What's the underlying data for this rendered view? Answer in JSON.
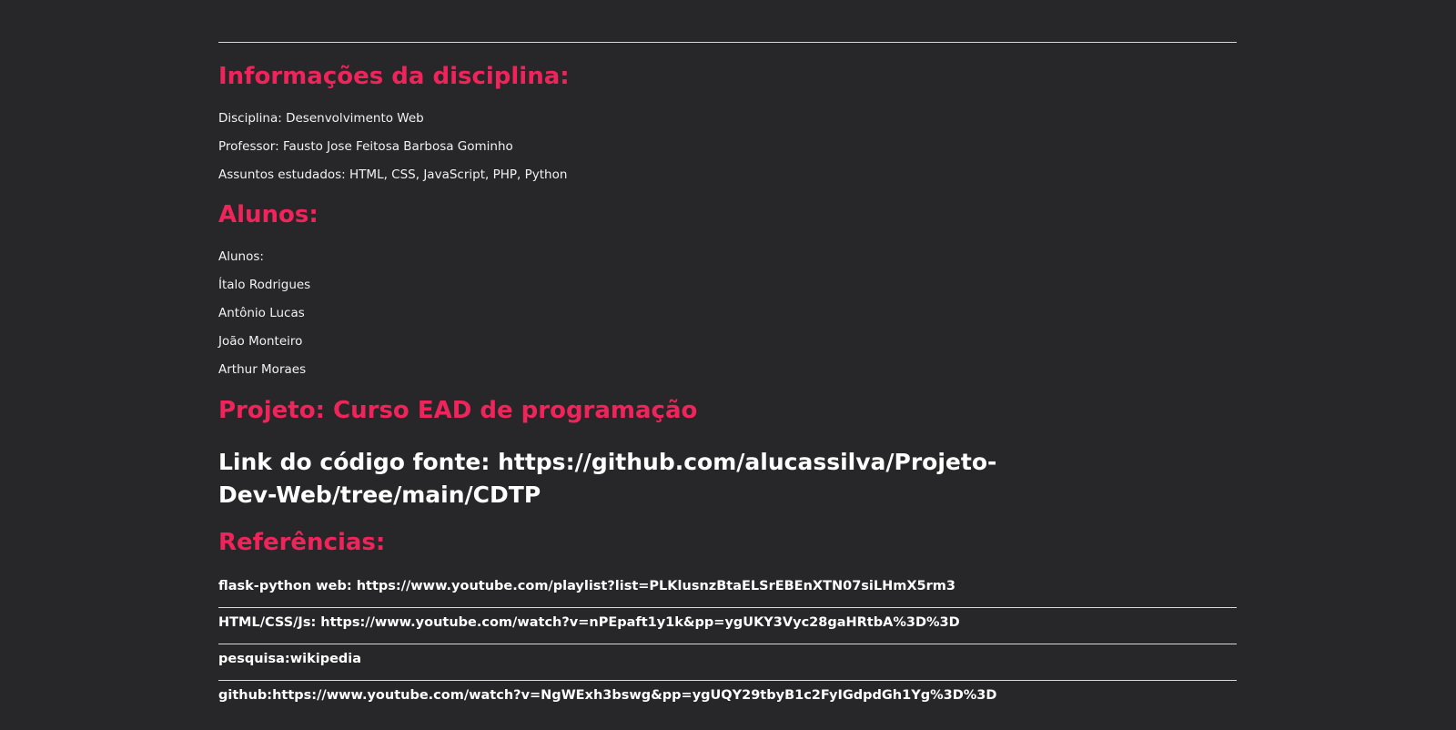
{
  "info": {
    "heading": "Informações da disciplina:",
    "disciplina": "Disciplina: Desenvolvimento Web",
    "professor": "Professor: Fausto Jose Feitosa Barbosa Gominho",
    "assuntos": "Assuntos estudados: HTML, CSS, JavaScript, PHP, Python"
  },
  "students": {
    "heading": "Alunos:",
    "label": "Alunos:",
    "names": [
      "Ítalo Rodrigues",
      "Antônio Lucas",
      "João Monteiro",
      "Arthur Moraes"
    ]
  },
  "project": {
    "heading": "Projeto: Curso EAD de programação",
    "source_link": "Link do código fonte: https://github.com/alucassilva/Projeto-Dev-Web/tree/main/CDTP"
  },
  "references": {
    "heading": "Referências:",
    "items": [
      "flask-python web: https://www.youtube.com/playlist?list=PLKlusnzBtaELSrEBEnXTN07siLHmX5rm3",
      "HTML/CSS/Js: https://www.youtube.com/watch?v=nPEpaft1y1k&pp=ygUKY3Vyc28gaHRtbA%3D%3D",
      "pesquisa:wikipedia",
      "github:https://www.youtube.com/watch?v=NgWExh3bswg&pp=ygUQY29tbyB1c2FyIGdpdGh1Yg%3D%3D"
    ]
  },
  "colors": {
    "background": "#27272a",
    "accent": "#f0245a",
    "text": "#f2f2f2",
    "rule": "#d8d8d8"
  }
}
